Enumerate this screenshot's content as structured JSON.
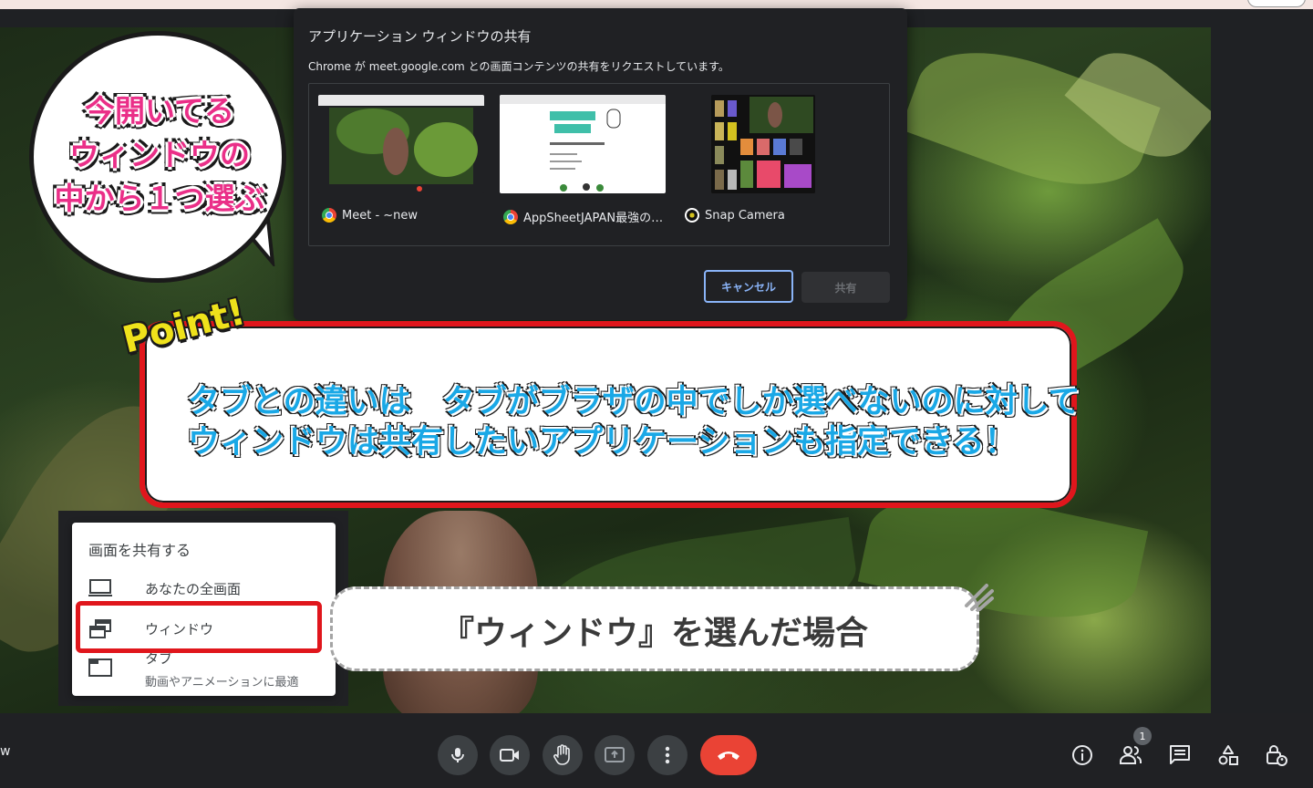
{
  "share_dialog": {
    "title": "アプリケーション ウィンドウの共有",
    "description": "Chrome が meet.google.com との画面コンテンツの共有をリクエストしています。",
    "windows": [
      {
        "label": "Meet - ~new",
        "icon": "chrome-icon"
      },
      {
        "label": "AppSheetJAPAN最強の…",
        "icon": "chrome-icon"
      },
      {
        "label": "Snap Camera",
        "icon": "snap-camera-icon"
      }
    ],
    "cancel_label": "キャンセル",
    "share_label": "共有"
  },
  "bubble": {
    "lines": [
      "今開いてる",
      "ウィンドウの",
      "中から１つ選ぶ"
    ]
  },
  "point_callout": {
    "tag": "Point!",
    "line1": "タブとの違いは　タブがブラザの中でしか選べないのに対して",
    "line2": "ウィンドウは共有したいアプリケーションも指定できる！"
  },
  "present_menu": {
    "title": "画面を共有する",
    "items": [
      {
        "label": "あなたの全画面",
        "icon": "monitor-icon"
      },
      {
        "label": "ウィンドウ",
        "icon": "window-icon"
      },
      {
        "label": "タブ",
        "sub": "動画やアニメーションに最適",
        "icon": "tab-icon"
      }
    ]
  },
  "caption": "『ウィンドウ』を選んだ場合",
  "meeting_name": "w",
  "controls": {
    "people_count": "1"
  },
  "colors": {
    "highlight_red": "#e0161c",
    "bubble_pink": "#ea2f88",
    "point_yellow": "#efe21b",
    "point_blue": "#1aa8e6",
    "leave_red": "#ea4335",
    "dialog_accent": "#8ab4f8"
  }
}
